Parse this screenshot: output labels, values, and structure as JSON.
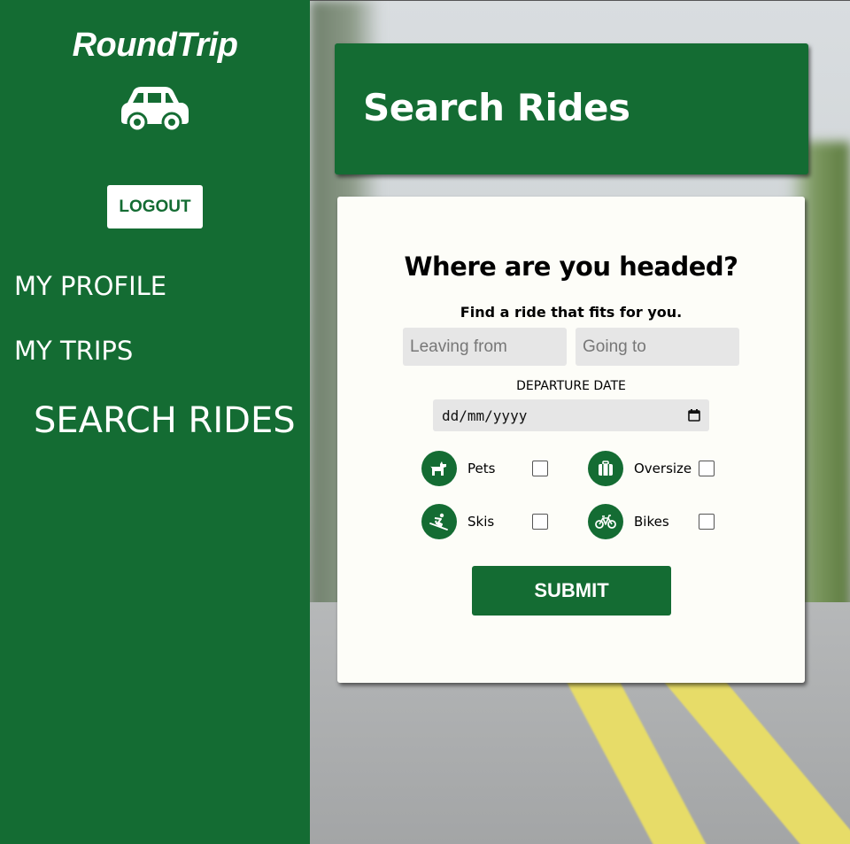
{
  "app": {
    "brand": "RoundTrip",
    "brand_color": "#146c33"
  },
  "sidebar": {
    "logout_label": "LOGOUT",
    "nav": [
      {
        "label": "MY PROFILE"
      },
      {
        "label": "MY TRIPS"
      },
      {
        "label": "SEARCH RIDES",
        "active": true
      }
    ]
  },
  "header": {
    "title": "Search Rides"
  },
  "form": {
    "heading": "Where are you headed?",
    "subheading": "Find a ride that fits for you.",
    "leaving_placeholder": "Leaving from",
    "going_placeholder": "Going to",
    "date_label": "DEPARTURE DATE",
    "date_value": "dd/mm/yyyy",
    "options": [
      {
        "label": "Pets",
        "icon": "dog-icon",
        "checked": false
      },
      {
        "label": "Oversize",
        "icon": "suitcase-icon",
        "checked": false
      },
      {
        "label": "Skis",
        "icon": "skier-icon",
        "checked": false
      },
      {
        "label": "Bikes",
        "icon": "bicycle-icon",
        "checked": false
      }
    ],
    "submit_label": "SUBMIT"
  }
}
